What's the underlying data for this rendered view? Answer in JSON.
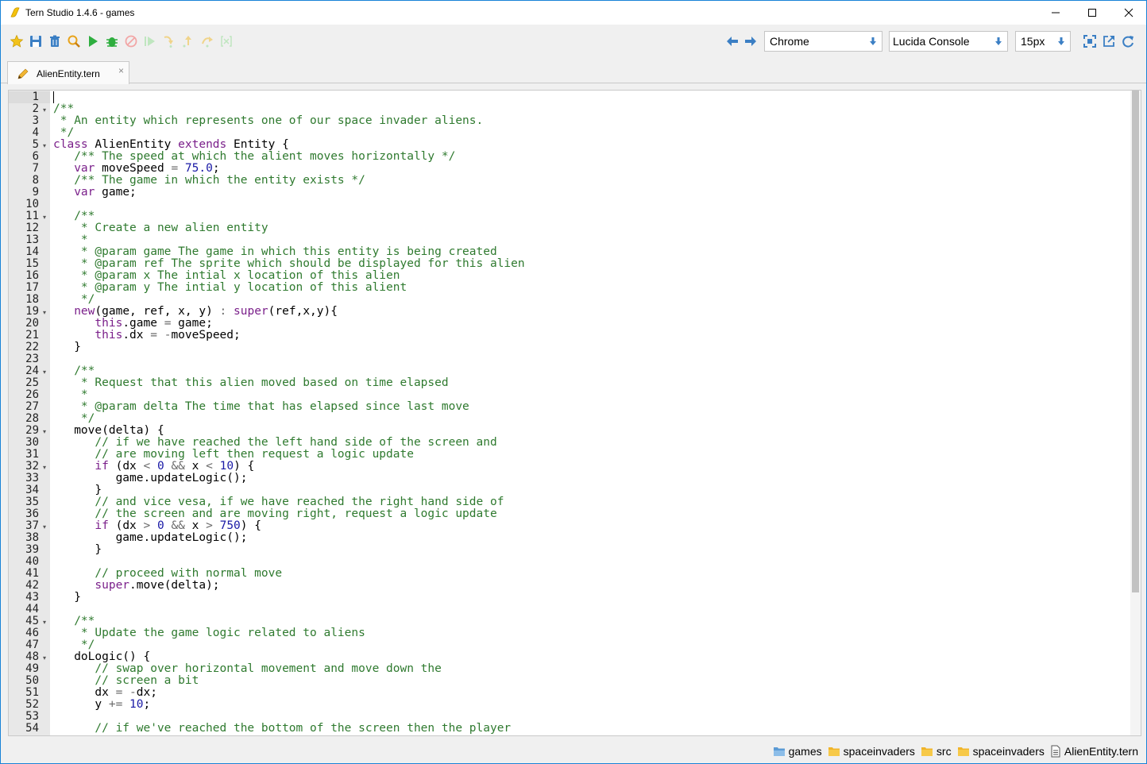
{
  "window": {
    "title": "Tern Studio 1.4.6 - games"
  },
  "toolbar": {
    "left_icons": [
      "star-icon",
      "save-icon",
      "trash-icon",
      "search-icon",
      "run-icon",
      "debug-icon",
      "stop-icon",
      "resume-icon",
      "step-in-icon",
      "step-out-icon",
      "step-over-icon",
      "evaluate-icon"
    ],
    "browser_select": "Chrome",
    "font_select": "Lucida Console",
    "size_select": "15px"
  },
  "tab": {
    "label": "AlienEntity.tern",
    "close": "×"
  },
  "editor": {
    "lines": [
      {
        "n": "1",
        "fold": false,
        "text": ""
      },
      {
        "n": "2",
        "fold": true,
        "text": "/**"
      },
      {
        "n": "3",
        "fold": false,
        "text": " * An entity which represents one of our space invader aliens."
      },
      {
        "n": "4",
        "fold": false,
        "text": " */"
      },
      {
        "n": "5",
        "fold": true,
        "text": "class AlienEntity extends Entity {"
      },
      {
        "n": "6",
        "fold": false,
        "text": "   /** The speed at which the alient moves horizontally */"
      },
      {
        "n": "7",
        "fold": false,
        "text": "   var moveSpeed = 75.0;"
      },
      {
        "n": "8",
        "fold": false,
        "text": "   /** The game in which the entity exists */"
      },
      {
        "n": "9",
        "fold": false,
        "text": "   var game;"
      },
      {
        "n": "10",
        "fold": false,
        "text": ""
      },
      {
        "n": "11",
        "fold": true,
        "text": "   /**"
      },
      {
        "n": "12",
        "fold": false,
        "text": "    * Create a new alien entity"
      },
      {
        "n": "13",
        "fold": false,
        "text": "    *"
      },
      {
        "n": "14",
        "fold": false,
        "text": "    * @param game The game in which this entity is being created"
      },
      {
        "n": "15",
        "fold": false,
        "text": "    * @param ref The sprite which should be displayed for this alien"
      },
      {
        "n": "16",
        "fold": false,
        "text": "    * @param x The intial x location of this alien"
      },
      {
        "n": "17",
        "fold": false,
        "text": "    * @param y The intial y location of this alient"
      },
      {
        "n": "18",
        "fold": false,
        "text": "    */"
      },
      {
        "n": "19",
        "fold": true,
        "text": "   new(game, ref, x, y) : super(ref,x,y){"
      },
      {
        "n": "20",
        "fold": false,
        "text": "      this.game = game;"
      },
      {
        "n": "21",
        "fold": false,
        "text": "      this.dx = -moveSpeed;"
      },
      {
        "n": "22",
        "fold": false,
        "text": "   }"
      },
      {
        "n": "23",
        "fold": false,
        "text": ""
      },
      {
        "n": "24",
        "fold": true,
        "text": "   /**"
      },
      {
        "n": "25",
        "fold": false,
        "text": "    * Request that this alien moved based on time elapsed"
      },
      {
        "n": "26",
        "fold": false,
        "text": "    *"
      },
      {
        "n": "27",
        "fold": false,
        "text": "    * @param delta The time that has elapsed since last move"
      },
      {
        "n": "28",
        "fold": false,
        "text": "    */"
      },
      {
        "n": "29",
        "fold": true,
        "text": "   move(delta) {"
      },
      {
        "n": "30",
        "fold": false,
        "text": "      // if we have reached the left hand side of the screen and"
      },
      {
        "n": "31",
        "fold": false,
        "text": "      // are moving left then request a logic update"
      },
      {
        "n": "32",
        "fold": true,
        "text": "      if (dx < 0 && x < 10) {"
      },
      {
        "n": "33",
        "fold": false,
        "text": "         game.updateLogic();"
      },
      {
        "n": "34",
        "fold": false,
        "text": "      }"
      },
      {
        "n": "35",
        "fold": false,
        "text": "      // and vice vesa, if we have reached the right hand side of"
      },
      {
        "n": "36",
        "fold": false,
        "text": "      // the screen and are moving right, request a logic update"
      },
      {
        "n": "37",
        "fold": true,
        "text": "      if (dx > 0 && x > 750) {"
      },
      {
        "n": "38",
        "fold": false,
        "text": "         game.updateLogic();"
      },
      {
        "n": "39",
        "fold": false,
        "text": "      }"
      },
      {
        "n": "40",
        "fold": false,
        "text": ""
      },
      {
        "n": "41",
        "fold": false,
        "text": "      // proceed with normal move"
      },
      {
        "n": "42",
        "fold": false,
        "text": "      super.move(delta);"
      },
      {
        "n": "43",
        "fold": false,
        "text": "   }"
      },
      {
        "n": "44",
        "fold": false,
        "text": ""
      },
      {
        "n": "45",
        "fold": true,
        "text": "   /**"
      },
      {
        "n": "46",
        "fold": false,
        "text": "    * Update the game logic related to aliens"
      },
      {
        "n": "47",
        "fold": false,
        "text": "    */"
      },
      {
        "n": "48",
        "fold": true,
        "text": "   doLogic() {"
      },
      {
        "n": "49",
        "fold": false,
        "text": "      // swap over horizontal movement and move down the"
      },
      {
        "n": "50",
        "fold": false,
        "text": "      // screen a bit"
      },
      {
        "n": "51",
        "fold": false,
        "text": "      dx = -dx;"
      },
      {
        "n": "52",
        "fold": false,
        "text": "      y += 10;"
      },
      {
        "n": "53",
        "fold": false,
        "text": ""
      },
      {
        "n": "54",
        "fold": false,
        "text": "      // if we've reached the bottom of the screen then the player"
      }
    ]
  },
  "breadcrumb": [
    {
      "label": "games",
      "icon": "folder-open-icon"
    },
    {
      "label": "spaceinvaders",
      "icon": "folder-icon"
    },
    {
      "label": "src",
      "icon": "folder-icon"
    },
    {
      "label": "spaceinvaders",
      "icon": "folder-icon"
    },
    {
      "label": "AlienEntity.tern",
      "icon": "file-icon"
    }
  ]
}
